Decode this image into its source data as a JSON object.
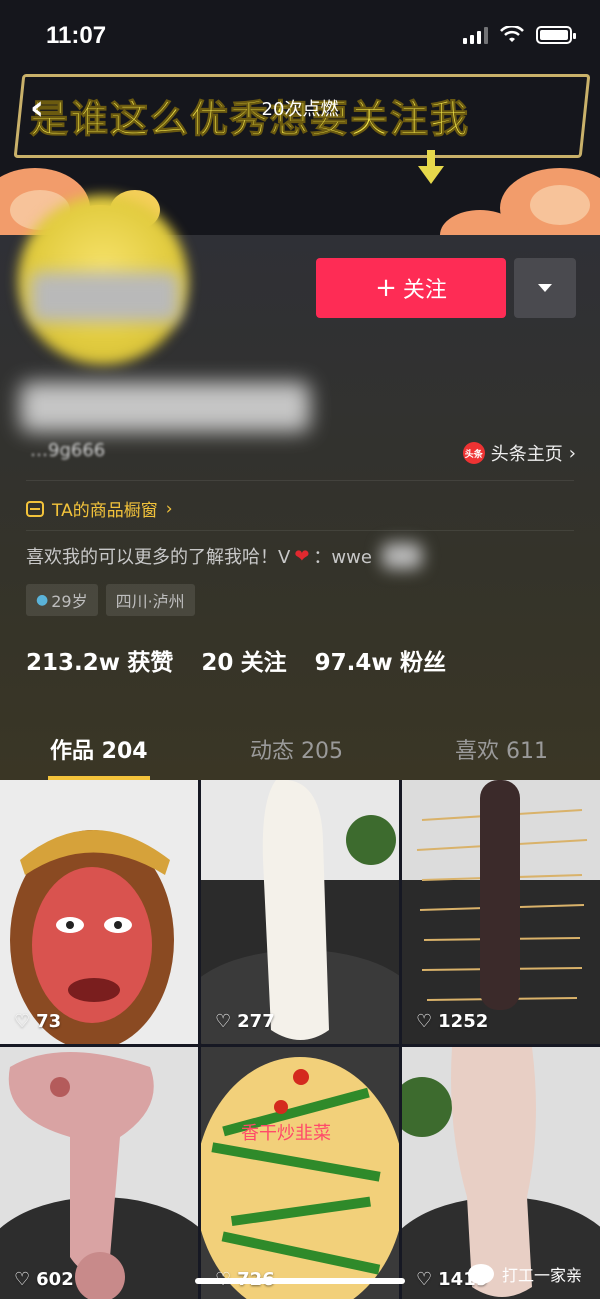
{
  "status_bar": {
    "time": "11:07"
  },
  "banner": {
    "headline": "是谁这么优秀想要关注我",
    "subtitle": "20次点燃"
  },
  "profile": {
    "follow_label": "关注",
    "id_text": "…9g666",
    "toutiao_label": "头条主页",
    "toutiao_logo_text": "头条",
    "shop_label": "TA的商品橱窗",
    "bio_text": "喜欢我的可以更多的了解我哈！V",
    "bio_suffix": "：wwe",
    "tags": {
      "age": "29岁",
      "location": "四川·泸州"
    },
    "stats": [
      {
        "value": "213.2w",
        "label": "获赞"
      },
      {
        "value": "20",
        "label": "关注"
      },
      {
        "value": "97.4w",
        "label": "粉丝"
      }
    ]
  },
  "tabs": [
    {
      "label": "作品 204"
    },
    {
      "label": "动态 205"
    },
    {
      "label": "喜欢 611"
    }
  ],
  "videos": [
    {
      "likes": "73",
      "icon": "monkey-king-face"
    },
    {
      "likes": "277",
      "icon": "white-daikon-in-pan"
    },
    {
      "likes": "1252",
      "icon": "toothpick-stuck-eggplant"
    },
    {
      "likes": "602",
      "icon": "raw-meat-bone"
    },
    {
      "likes": "726",
      "icon": "stir-fry-greens-tofu"
    },
    {
      "likes": "1419",
      "icon": "pale-meat-in-pan"
    }
  ],
  "video_overlay_text": "香干炒韭菜",
  "watermark": "打工一家亲",
  "colors": {
    "accent": "#fe2c55",
    "tab_underline": "#f3c33b",
    "background": "#161823"
  }
}
